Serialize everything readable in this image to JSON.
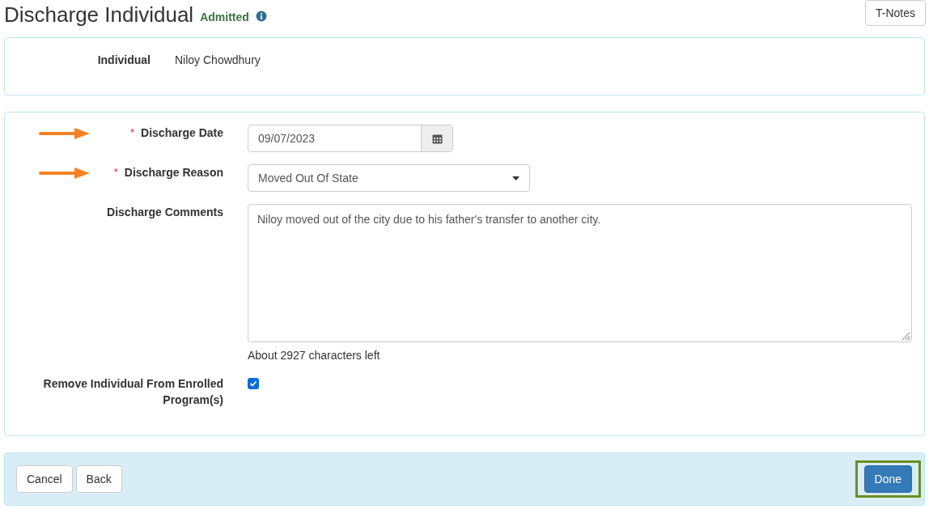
{
  "page_title": "Discharge Individual",
  "status_badge": "Admitted",
  "header_button": "T-Notes",
  "required_mark": "*",
  "individual": {
    "label": "Individual",
    "value": "Niloy Chowdhury"
  },
  "fields": [
    {
      "kind": "date",
      "label": "Discharge Date",
      "required": true,
      "marked": true,
      "value": "09/07/2023"
    },
    {
      "kind": "select",
      "label": "Discharge Reason",
      "required": true,
      "marked": true,
      "value": "Moved Out Of State"
    },
    {
      "kind": "textarea",
      "label": "Discharge Comments",
      "required": false,
      "marked": false,
      "value": "Niloy moved out of the city due to his father's transfer to another city.",
      "help": "About 2927 characters left"
    },
    {
      "kind": "checkbox",
      "label": "Remove Individual From Enrolled Program(s)",
      "required": false,
      "marked": false,
      "checked": true
    }
  ],
  "footer_buttons": [
    {
      "label": "Cancel",
      "kind": "default",
      "highlighted": false
    },
    {
      "label": "Back",
      "kind": "default",
      "highlighted": false
    },
    {
      "label": "Done",
      "kind": "primary",
      "highlighted": true
    }
  ]
}
